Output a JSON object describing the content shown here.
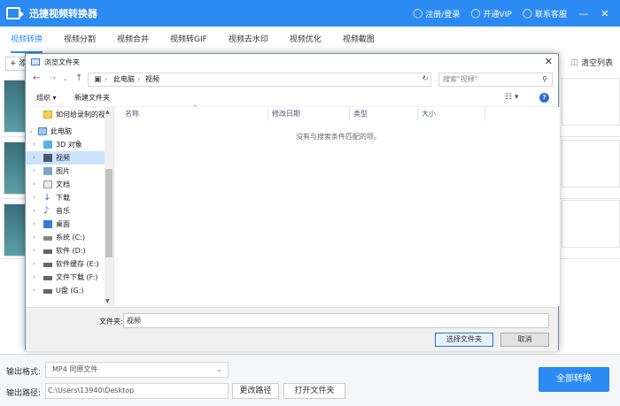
{
  "app": {
    "title": "迅捷视频转换器",
    "login": "注册/登录",
    "vip": "开通VIP",
    "service": "联系客服",
    "brand_color": "#2b8bf2"
  },
  "tabs": [
    {
      "label": "视频转换",
      "active": true
    },
    {
      "label": "视频分割"
    },
    {
      "label": "视频合并"
    },
    {
      "label": "视频转GIF"
    },
    {
      "label": "视频去水印"
    },
    {
      "label": "视频优化"
    },
    {
      "label": "视频截图"
    }
  ],
  "toolbar": {
    "add_label": "+ 添",
    "clear_label": "清空列表"
  },
  "bottom": {
    "format_label": "输出格式:",
    "format_value": "MP4  同原文件",
    "path_label": "输出路径:",
    "path_value": "C:\\Users\\13940\\Desktop",
    "change_path": "更改路径",
    "open_folder": "打开文件夹",
    "convert_all": "全部转换"
  },
  "dialog": {
    "title": "浏览文件夹",
    "address_root": "此电脑",
    "address_current": "视频",
    "search_placeholder": "搜索\"视频\"",
    "organize": "组织 ▾",
    "new_folder": "新建文件夹",
    "tree": [
      {
        "label": "如何给录制的视",
        "icon": "folder-icon",
        "level": "top"
      },
      {
        "label": "此电脑",
        "icon": "computer-icon",
        "expanded": true
      },
      {
        "label": "3D 对象",
        "icon": "3d-objects-icon"
      },
      {
        "label": "视频",
        "icon": "videos-icon",
        "selected": true
      },
      {
        "label": "图片",
        "icon": "pictures-icon"
      },
      {
        "label": "文档",
        "icon": "documents-icon"
      },
      {
        "label": "下载",
        "icon": "downloads-icon"
      },
      {
        "label": "音乐",
        "icon": "music-icon"
      },
      {
        "label": "桌面",
        "icon": "desktop-icon"
      },
      {
        "label": "系统 (C:)",
        "icon": "drive-icon"
      },
      {
        "label": "软件 (D:)",
        "icon": "drive-icon"
      },
      {
        "label": "软件缓存 (E:)",
        "icon": "drive-icon"
      },
      {
        "label": "文件下载 (F:)",
        "icon": "drive-icon"
      },
      {
        "label": "U盘 (G:)",
        "icon": "drive-icon"
      }
    ],
    "columns": [
      "名称",
      "修改日期",
      "类型",
      "大小"
    ],
    "empty_message": "没有与搜索条件匹配的项。",
    "folder_label": "文件夹:",
    "folder_value": "视频",
    "select_button": "选择文件夹",
    "cancel_button": "取消"
  }
}
